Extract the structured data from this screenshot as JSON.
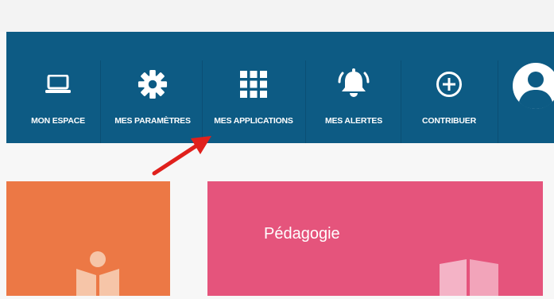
{
  "nav": {
    "items": [
      {
        "label": "MON ESPACE",
        "icon": "laptop-icon"
      },
      {
        "label": "MES PARAMÈTRES",
        "icon": "gear-icon"
      },
      {
        "label": "MES APPLICATIONS",
        "icon": "apps-grid-icon"
      },
      {
        "label": "MES ALERTES",
        "icon": "bell-icon"
      },
      {
        "label": "CONTRIBUER",
        "icon": "plus-circle-icon"
      },
      {
        "label": "",
        "icon": "user-avatar-icon"
      }
    ]
  },
  "cards": {
    "pedagogie": {
      "title": "Pédagogie",
      "icon": "book-icon"
    },
    "orange": {
      "icon": "reader-icon"
    }
  },
  "colors": {
    "nav_bg": "#0d5b84",
    "card_orange": "#ec7845",
    "card_pink": "#e5547c",
    "arrow": "#e0201c"
  }
}
